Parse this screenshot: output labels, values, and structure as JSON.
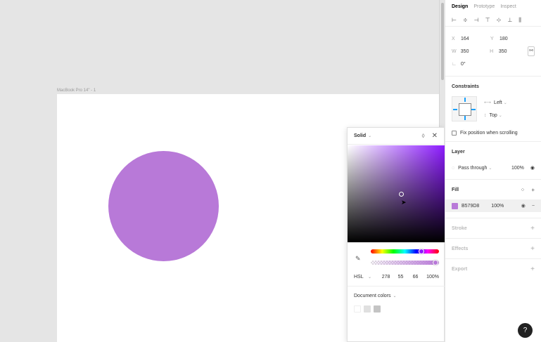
{
  "canvas": {
    "frame_label": "MacBook Pro 14\" - 1",
    "ellipse_color": "#B879D8",
    "background": "#e5e5e5"
  },
  "picker": {
    "mode": "Solid",
    "close_glyph": "✕",
    "color_model": "HSL",
    "h": "278",
    "s": "55",
    "l": "66",
    "alpha": "100%",
    "document_colors_label": "Document colors",
    "swatches": [
      "#ffffff",
      "#e0e0e0",
      "#c4c4c4"
    ],
    "hue_color": "#8c1aff"
  },
  "panel": {
    "tabs": [
      "Design",
      "Prototype",
      "Inspect"
    ],
    "active_tab": "Design",
    "x_label": "X",
    "x_value": "164",
    "y_label": "Y",
    "y_value": "180",
    "w_label": "W",
    "w_value": "350",
    "h_label": "H",
    "h_value": "350",
    "rotation_value": "0°",
    "constraints_title": "Constraints",
    "constraint_h": "Left",
    "constraint_v": "Top",
    "fix_position_label": "Fix position when scrolling",
    "layer_title": "Layer",
    "blend_mode": "Pass through",
    "layer_opacity": "100%",
    "fill_title": "Fill",
    "fill_hex": "B579D8",
    "fill_opacity": "100%",
    "stroke_title": "Stroke",
    "effects_title": "Effects",
    "export_title": "Export"
  },
  "help_label": "?"
}
